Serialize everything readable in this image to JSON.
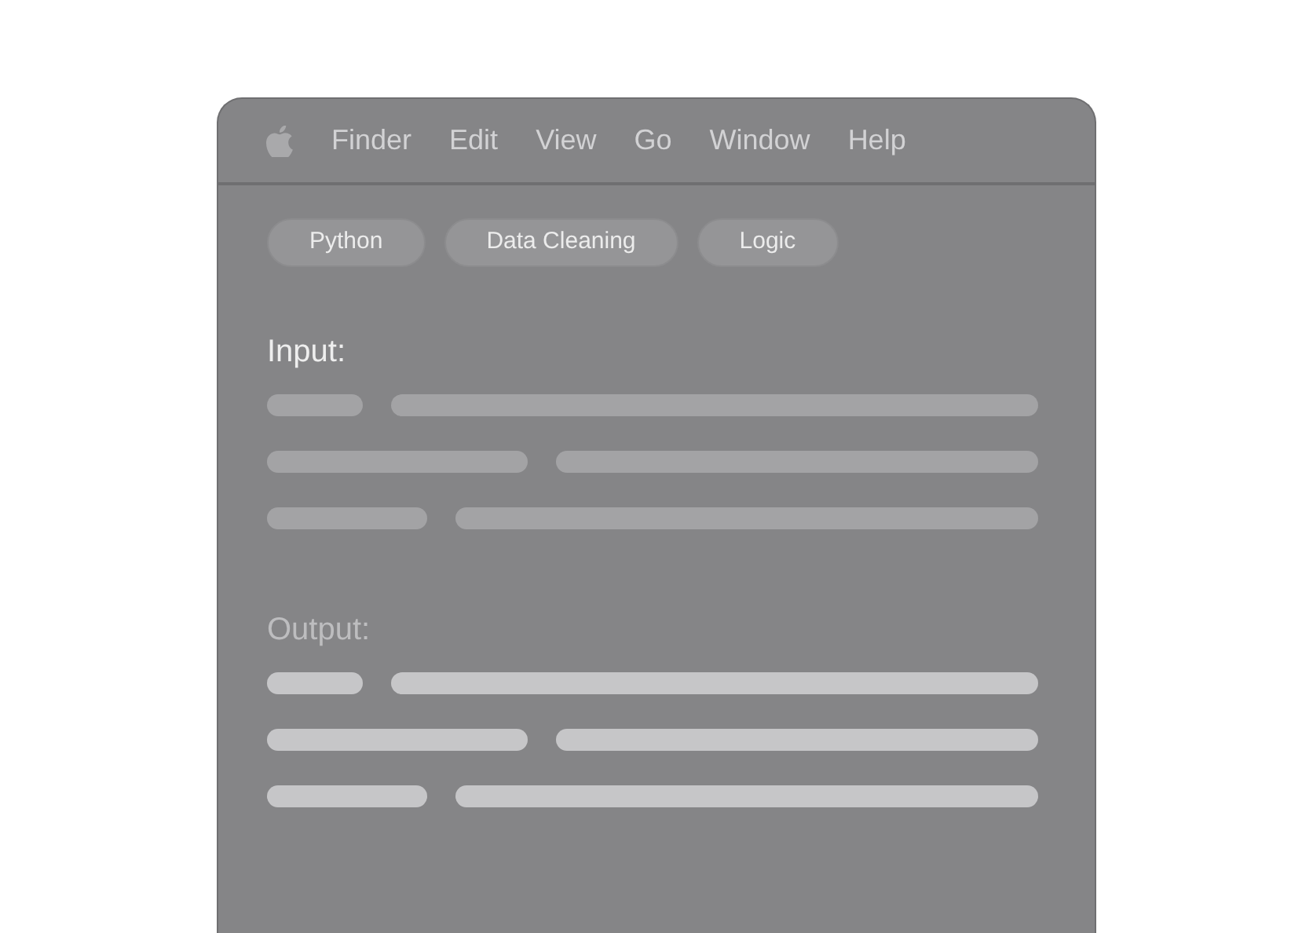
{
  "menu_bar": {
    "items": [
      "Finder",
      "Edit",
      "View",
      "Go",
      "Window",
      "Help"
    ]
  },
  "tags": [
    "Python",
    "Data Cleaning",
    "Logic"
  ],
  "sections": [
    {
      "kind": "input",
      "label": "Input:"
    },
    {
      "kind": "output",
      "label": "Output:"
    }
  ]
}
